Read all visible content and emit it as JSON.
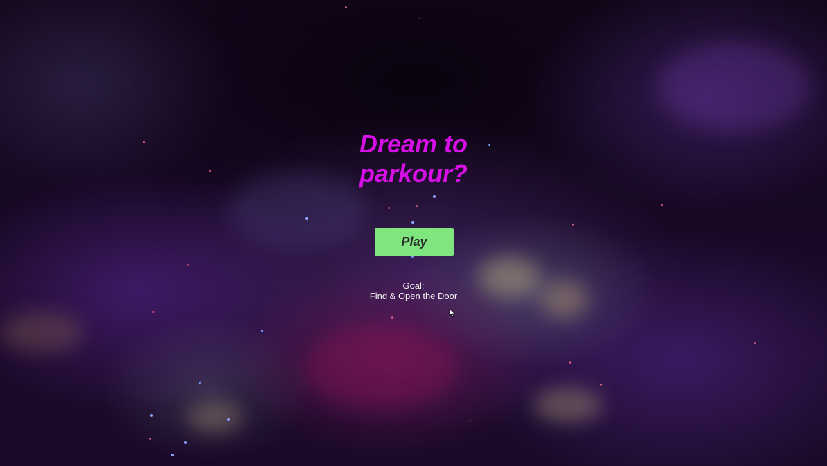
{
  "menu": {
    "title": "Dream to parkour?",
    "play_label": "Play",
    "goal_label": "Goal:",
    "goal_text": "Find & Open the Door"
  },
  "colors": {
    "title": "#d60fe6",
    "play_button": "#7fe57f",
    "goal_text": "#f2f2f2"
  },
  "icons": {
    "pointer": "mouse-cursor-icon"
  }
}
